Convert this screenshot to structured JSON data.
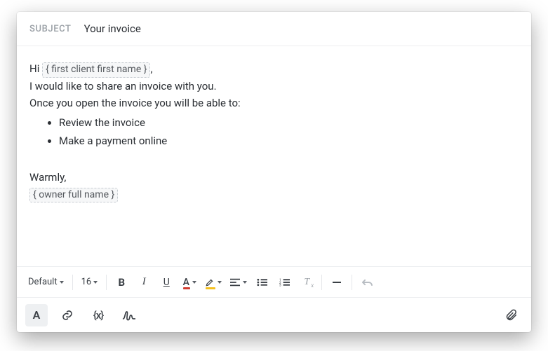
{
  "subject": {
    "label": "SUBJECT",
    "value": "Your invoice"
  },
  "body": {
    "greeting_prefix": "Hi ",
    "greeting_token": "{ first client first name }",
    "greeting_suffix": ",",
    "line1": "I would like to share an invoice with you.",
    "line2": "Once you open the invoice you will be able to:",
    "bullets": [
      "Review the invoice",
      "Make a payment online"
    ],
    "signoff": "Warmly,",
    "signature_token": "{ owner full name }"
  },
  "toolbar": {
    "font_family": "Default",
    "font_size": "16"
  },
  "secondary": {
    "variable_label": "{x}"
  }
}
